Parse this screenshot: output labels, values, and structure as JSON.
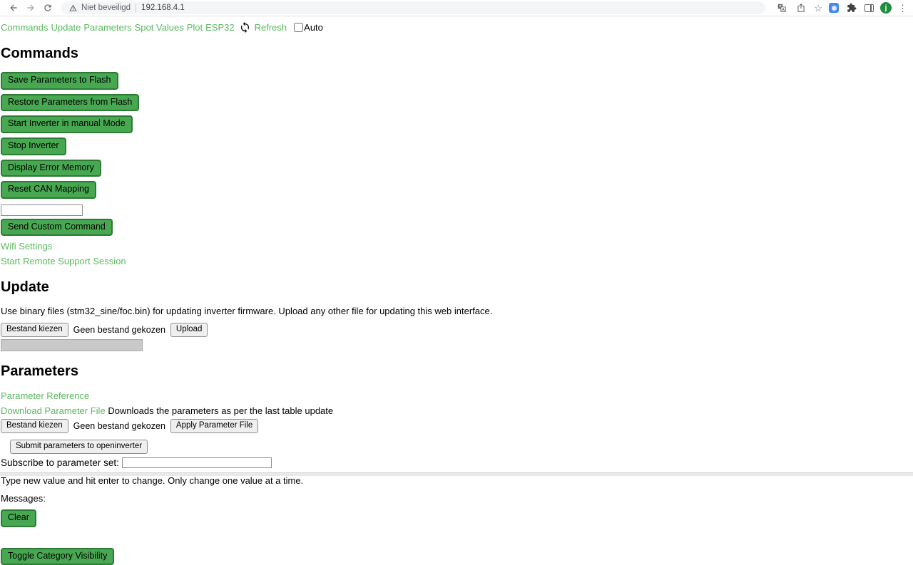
{
  "browser": {
    "security_label": "Niet beveiligd",
    "url": "192.168.4.1",
    "avatar_letter": "j"
  },
  "nav": {
    "links": [
      "Commands",
      "Update",
      "Parameters",
      "Spot Values",
      "Plot",
      "ESP32"
    ],
    "refresh_label": "Refresh",
    "auto_label": "Auto",
    "auto_checked": false
  },
  "commands": {
    "heading": "Commands",
    "buttons": [
      "Save Parameters to Flash",
      "Restore Parameters from Flash",
      "Start Inverter in manual Mode",
      "Stop Inverter",
      "Display Error Memory",
      "Reset CAN Mapping"
    ],
    "custom_command_value": "",
    "send_button": "Send Custom Command",
    "links": [
      "Wifi Settings",
      "Start Remote Support Session"
    ]
  },
  "update": {
    "heading": "Update",
    "description": "Use binary files (stm32_sine/foc.bin) for updating inverter firmware. Upload any other file for updating this web interface.",
    "file_button": "Bestand kiezen",
    "file_status": "Geen bestand gekozen",
    "upload_button": "Upload"
  },
  "parameters": {
    "heading": "Parameters",
    "reference_link": "Parameter Reference",
    "download_link": "Download Parameter File",
    "download_note": "Downloads the parameters as per the last table update",
    "file_button": "Bestand kiezen",
    "file_status": "Geen bestand gekozen",
    "apply_button": "Apply Parameter File",
    "submit_button": "Submit parameters to openinverter",
    "subscribe_label": "Subscribe to parameter set:",
    "subscribe_value": "",
    "hint": "Type new value and hit enter to change. Only change one value at a time.",
    "messages_label": "Messages:",
    "clear_button": "Clear"
  },
  "footer": {
    "toggle_button": "Toggle Category Visibility"
  },
  "colors": {
    "button_green": "#48a852",
    "button_green_border": "#2c7a33",
    "link_green": "#5bb85f",
    "avatar_green": "#1e8e3e"
  }
}
